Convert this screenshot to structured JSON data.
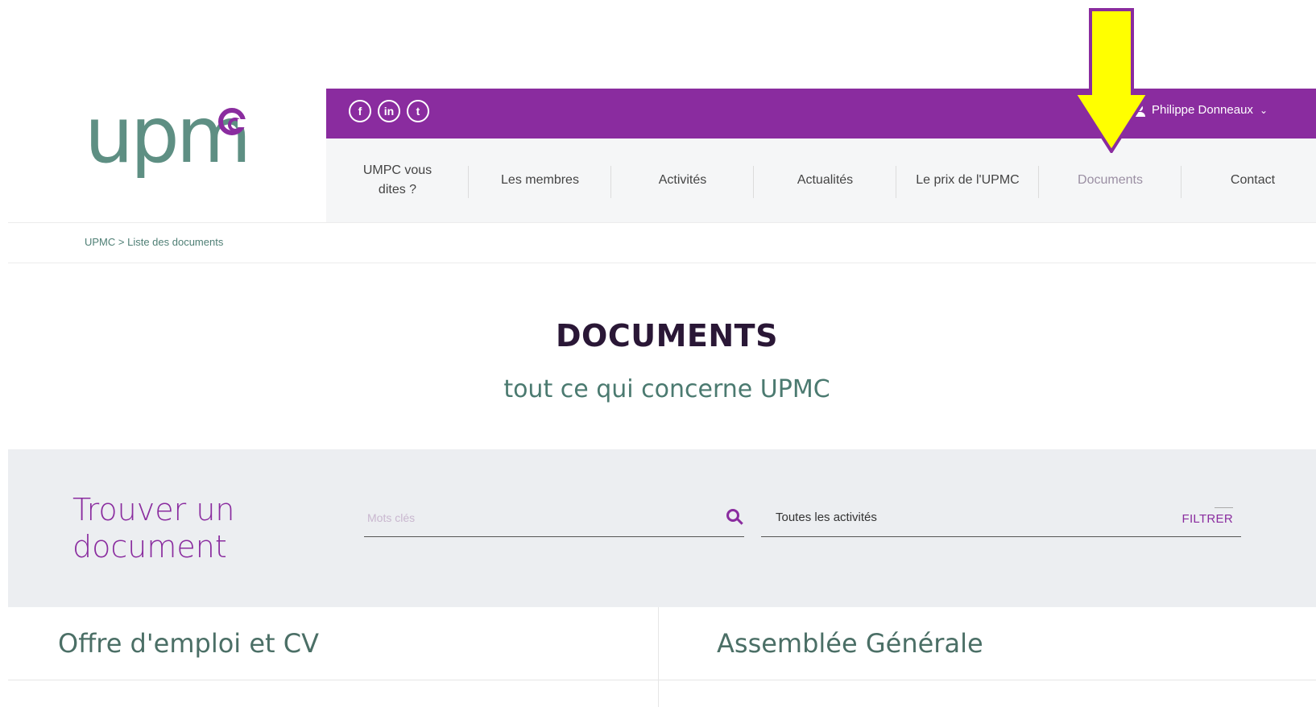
{
  "logo": {
    "text": "upm"
  },
  "topbar": {
    "social": [
      {
        "icon": "facebook-icon",
        "glyph": "f"
      },
      {
        "icon": "linkedin-icon",
        "glyph": "in"
      },
      {
        "icon": "twitter-icon",
        "glyph": "t"
      }
    ],
    "user_name": "Philippe Donneaux",
    "user_caret": "⌄"
  },
  "nav": {
    "items": [
      {
        "label": "UMPC vous dites ?"
      },
      {
        "label": "Les membres"
      },
      {
        "label": "Activités"
      },
      {
        "label": "Actualités"
      },
      {
        "label": "Le prix de l'UPMC"
      },
      {
        "label": "Documents"
      },
      {
        "label": "Contact"
      }
    ]
  },
  "breadcrumb": "UPMC > Liste des documents",
  "page": {
    "title": "DOCUMENTS",
    "subtitle": "tout ce qui concerne UPMC"
  },
  "search": {
    "title": "Trouver un document",
    "keyword_placeholder": "Mots clés",
    "activity_value": "Toutes les activités",
    "filter_label": "FILTRER"
  },
  "categories": [
    {
      "label": "Offre d'emploi et CV"
    },
    {
      "label": "Assemblée Générale"
    }
  ],
  "colors": {
    "purple": "#8a2c9f",
    "green": "#5e8f83",
    "annotation_yellow": "#ffff00"
  }
}
